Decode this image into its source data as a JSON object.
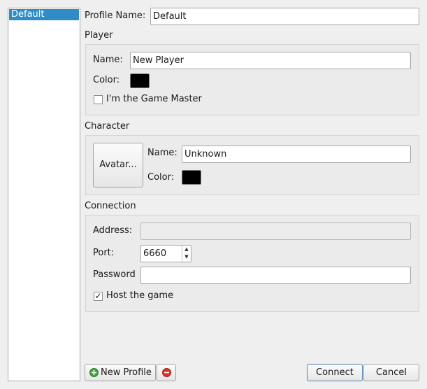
{
  "profiles": {
    "items": [
      "Default"
    ],
    "selected": "Default"
  },
  "profile_name": {
    "label": "Profile Name:",
    "value": "Default"
  },
  "player": {
    "title": "Player",
    "name_label": "Name:",
    "name_value": "New Player",
    "color_label": "Color:",
    "color_value": "#000000",
    "gm_label": "I'm the Game Master",
    "gm_checked": false
  },
  "character": {
    "title": "Character",
    "avatar_label": "Avatar...",
    "name_label": "Name:",
    "name_value": "Unknown",
    "color_label": "Color:",
    "color_value": "#000000"
  },
  "connection": {
    "title": "Connection",
    "address_label": "Address:",
    "address_value": "",
    "port_label": "Port:",
    "port_value": "6660",
    "password_label": "Password",
    "password_value": "",
    "host_label": "Host the game",
    "host_checked": true,
    "host_check_glyph": "✓"
  },
  "buttons": {
    "new_profile": "New Profile",
    "connect": "Connect",
    "cancel": "Cancel"
  },
  "icons": {
    "add": "add-icon",
    "remove": "remove-icon",
    "add_color": "#3ca63c",
    "remove_color": "#d9342b"
  }
}
